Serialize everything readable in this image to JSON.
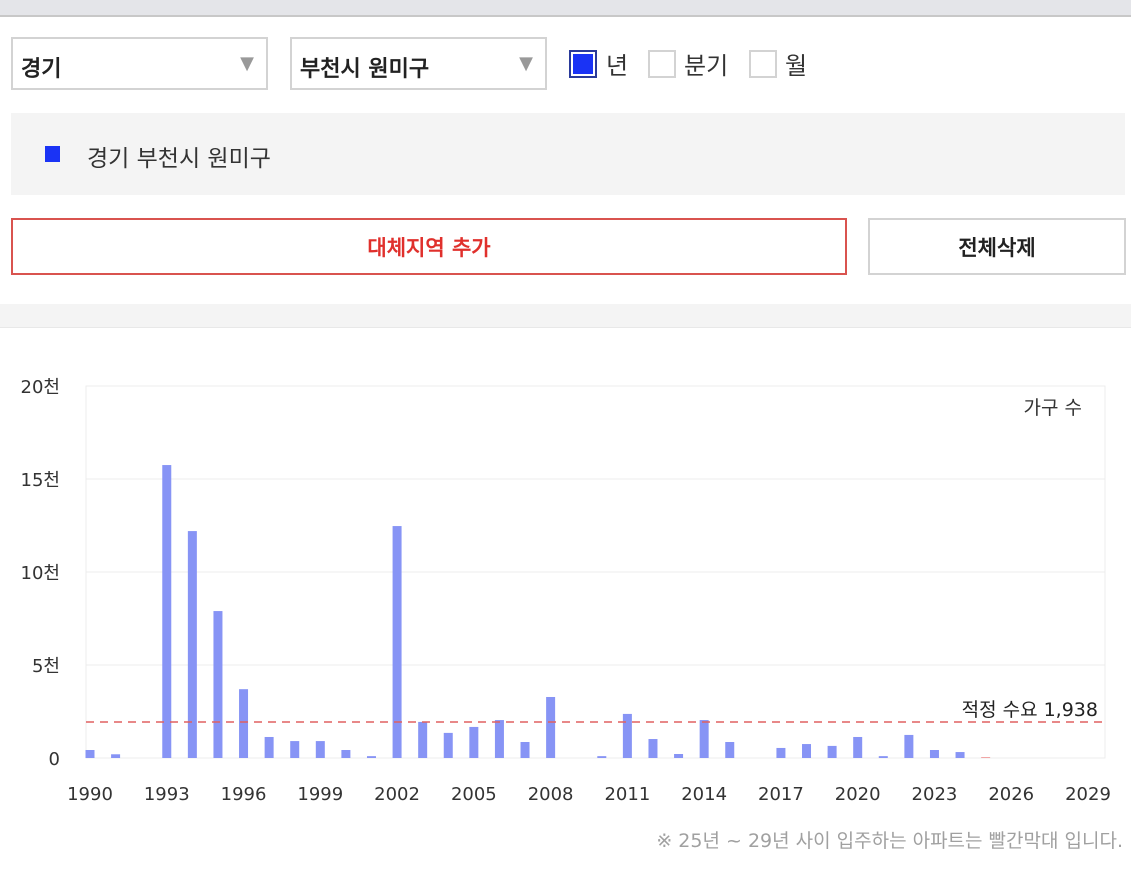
{
  "filters": {
    "region": "경기",
    "district": "부천시 원미구",
    "periods": [
      {
        "label": "년",
        "checked": true
      },
      {
        "label": "분기",
        "checked": false
      },
      {
        "label": "월",
        "checked": false
      }
    ]
  },
  "legend": {
    "label": "경기 부천시 원미구",
    "color": "#1a33f5"
  },
  "buttons": {
    "add": "대체지역 추가",
    "delete_all": "전체삭제"
  },
  "note": "※ 25년 ~ 29년 사이 입주하는 아파트는 빨간막대 입니다.",
  "chart_data": {
    "type": "bar",
    "series_label": "가구 수",
    "x": [
      1990,
      1991,
      1992,
      1993,
      1994,
      1995,
      1996,
      1997,
      1998,
      1999,
      2000,
      2001,
      2002,
      2003,
      2004,
      2005,
      2006,
      2007,
      2008,
      2009,
      2010,
      2011,
      2012,
      2013,
      2014,
      2015,
      2016,
      2017,
      2018,
      2019,
      2020,
      2021,
      2022,
      2023,
      2024,
      2025,
      2026,
      2027,
      2028,
      2029
    ],
    "values": [
      430,
      200,
      0,
      15750,
      12200,
      7900,
      3700,
      1130,
      910,
      910,
      430,
      100,
      12470,
      1940,
      1350,
      1670,
      2040,
      860,
      3280,
      0,
      100,
      2370,
      1020,
      215,
      2040,
      860,
      0,
      540,
      750,
      650,
      1130,
      100,
      1240,
      430,
      320,
      50,
      0,
      0,
      0,
      0
    ],
    "xticks": [
      "1990",
      "1993",
      "1996",
      "1999",
      "2002",
      "2005",
      "2008",
      "2011",
      "2014",
      "2017",
      "2020",
      "2023",
      "2026",
      "2029"
    ],
    "yticks": [
      {
        "v": 0,
        "label": "0"
      },
      {
        "v": 5000,
        "label": "5천"
      },
      {
        "v": 10000,
        "label": "10천"
      },
      {
        "v": 15000,
        "label": "15천"
      },
      {
        "v": 20000,
        "label": "20천"
      }
    ],
    "ylim": [
      0,
      20000
    ],
    "reference": {
      "value": 1938,
      "label": "적정 수요 1,938",
      "color": "#e06060"
    },
    "bar_color": "#8794f5",
    "future_bar_color": "#f0a0a0"
  }
}
